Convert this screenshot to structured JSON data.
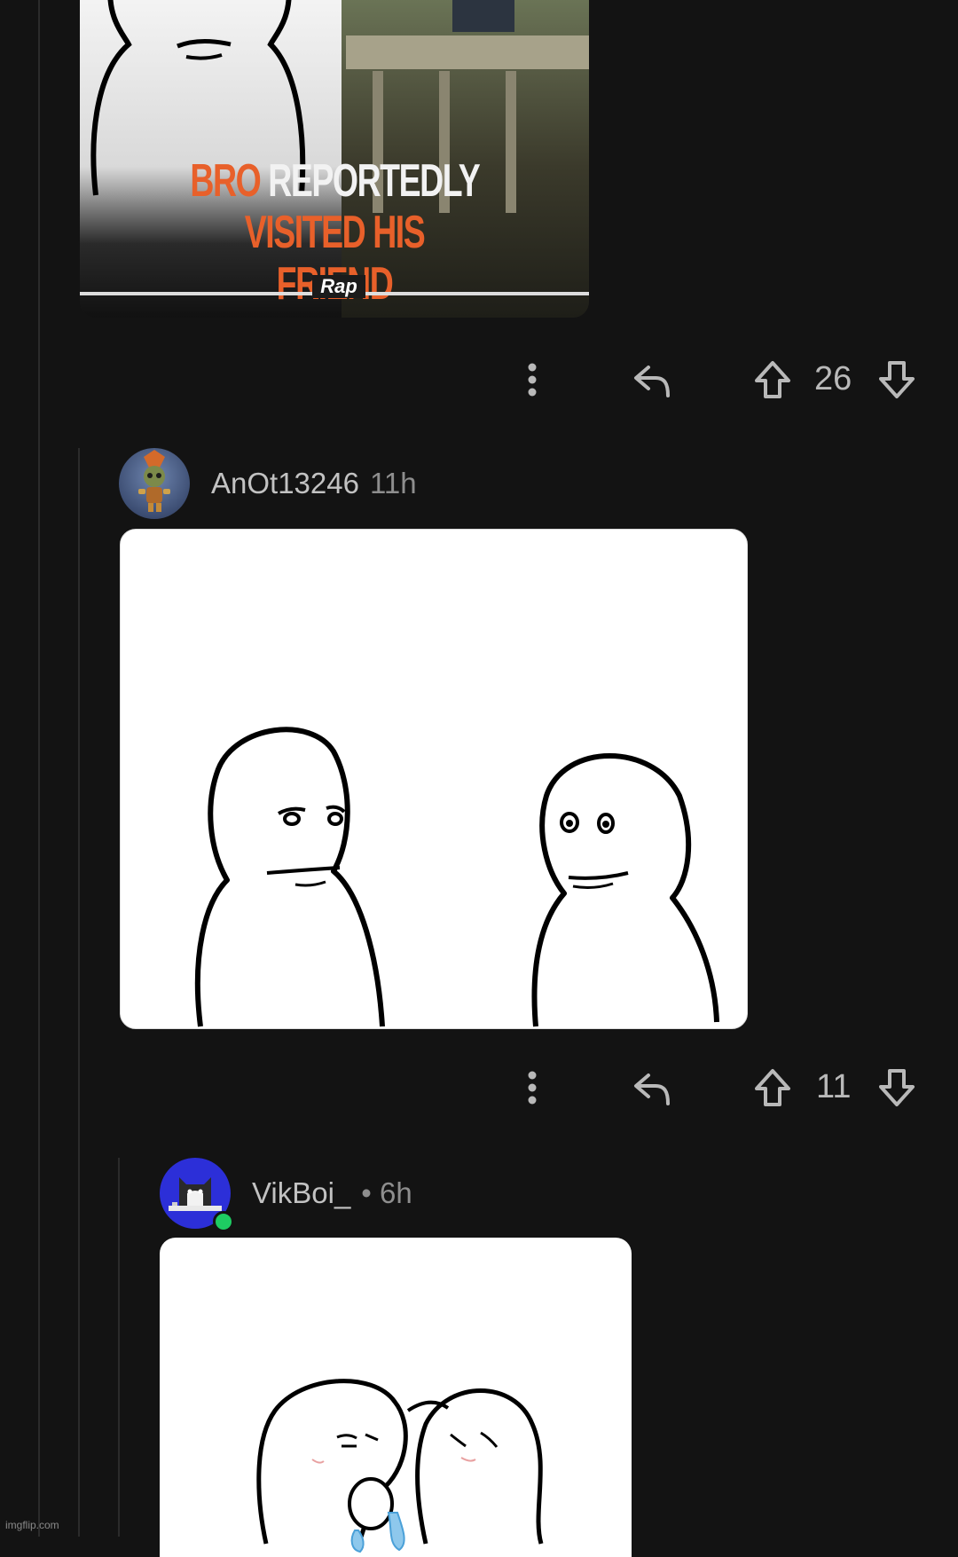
{
  "post_image": {
    "caption_part1": "BRO",
    "caption_part2": "REPORTEDLY",
    "caption_part3": "VISITED HIS",
    "caption_line2": "FRIEND",
    "logo": "Rap"
  },
  "post_actions": {
    "upvotes": "26"
  },
  "comment1": {
    "username": "AnOt13246",
    "time": "11h",
    "upvotes": "11"
  },
  "comment2": {
    "username": "VikBoi_",
    "time": "• 6h"
  },
  "footer": {
    "watermark": "imgflip.com"
  },
  "colors": {
    "background": "#131313",
    "caption_orange": "#e8602a",
    "online_green": "#1ecc62",
    "avatar_blue": "#2c2fd8"
  },
  "icons": [
    "more-options-icon",
    "reply-icon",
    "upvote-icon",
    "downvote-icon"
  ]
}
